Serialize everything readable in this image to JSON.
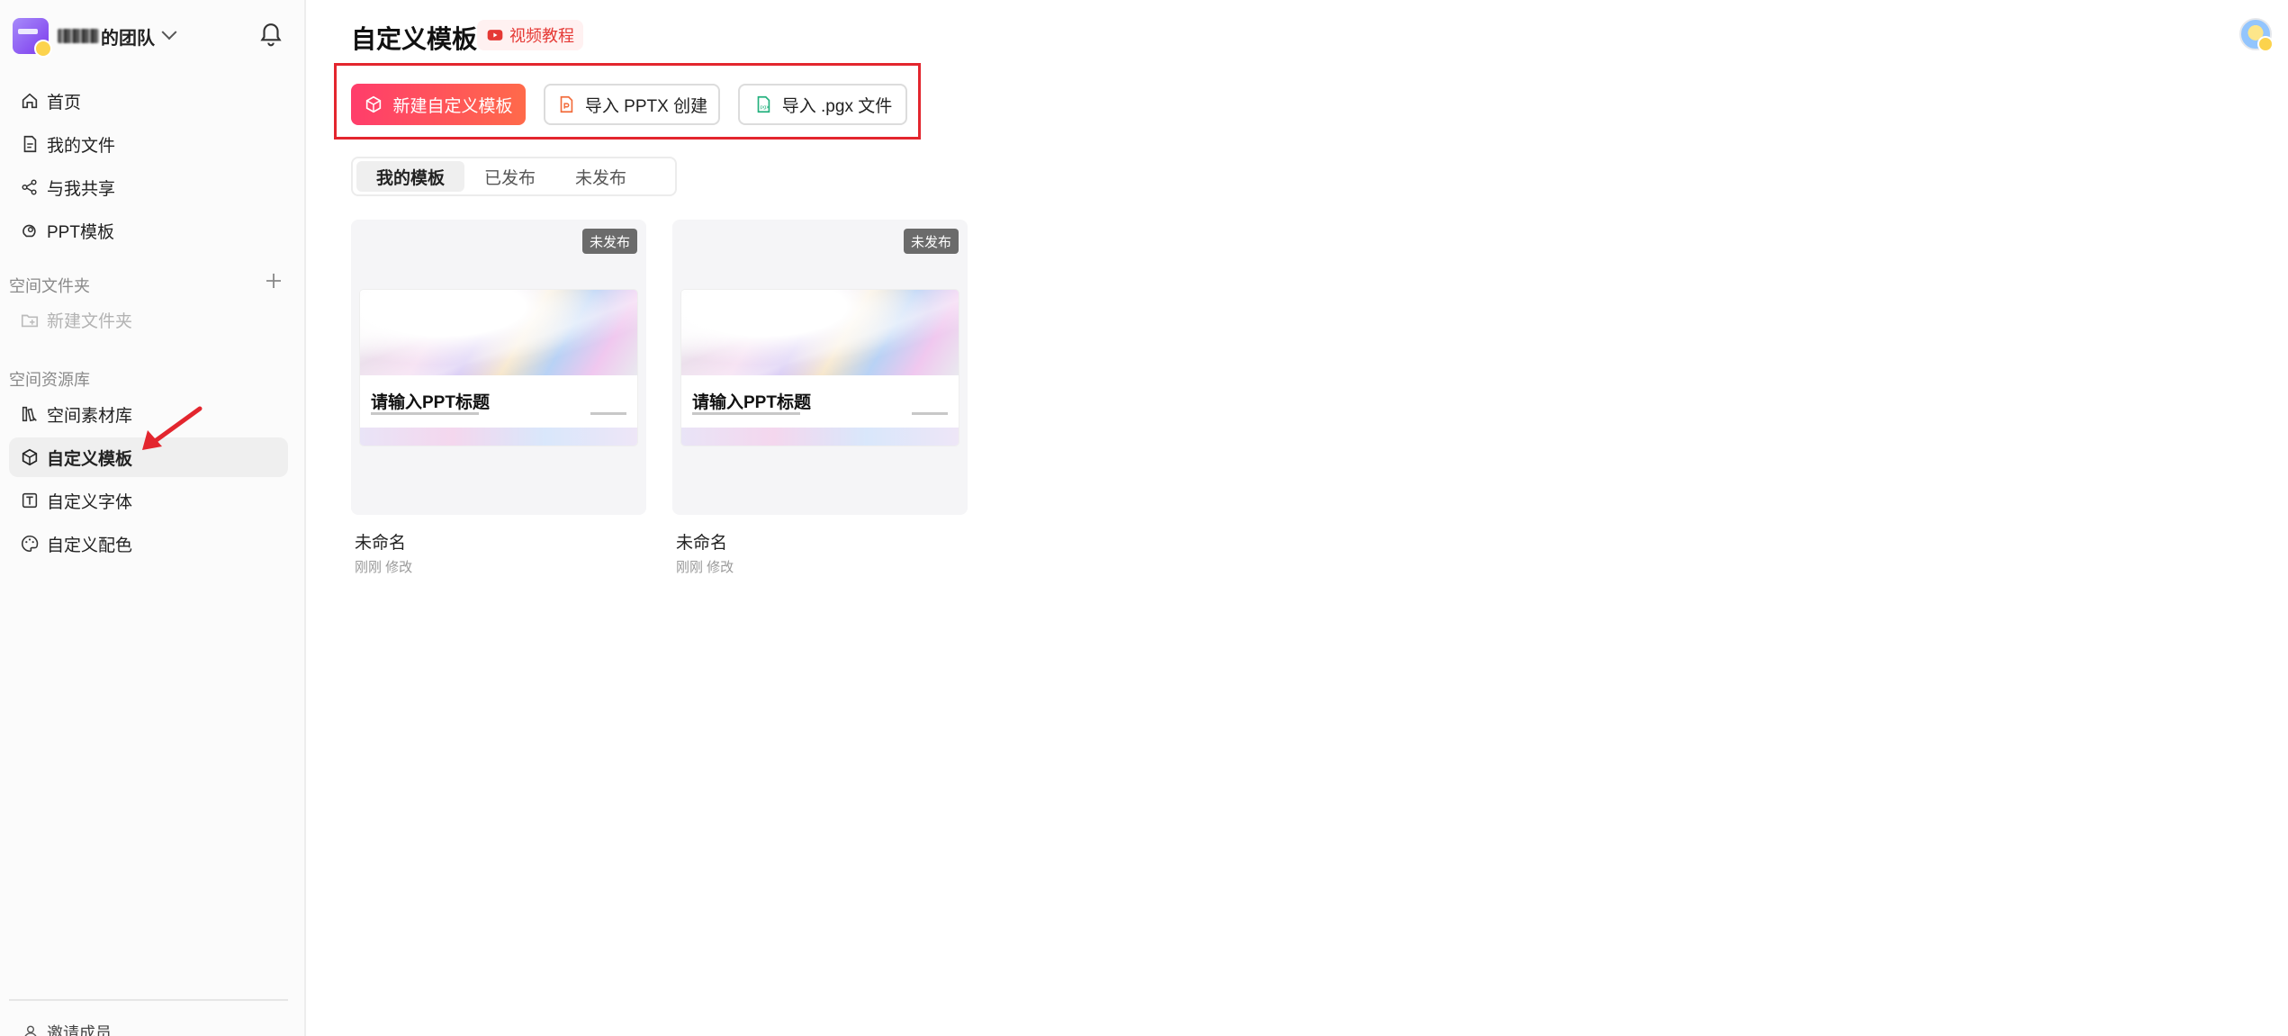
{
  "team": {
    "name_suffix": "的团队"
  },
  "sidebar": {
    "nav": [
      {
        "label": "首页",
        "icon": "home-icon"
      },
      {
        "label": "我的文件",
        "icon": "file-icon"
      },
      {
        "label": "与我共享",
        "icon": "share-icon"
      },
      {
        "label": "PPT模板",
        "icon": "template-icon"
      }
    ],
    "space_folder_label": "空间文件夹",
    "new_folder_label": "新建文件夹",
    "space_library_label": "空间资源库",
    "library": [
      {
        "label": "空间素材库",
        "icon": "material-icon"
      },
      {
        "label": "自定义模板",
        "icon": "cube-icon",
        "active": true
      },
      {
        "label": "自定义字体",
        "icon": "font-icon"
      },
      {
        "label": "自定义配色",
        "icon": "palette-icon"
      }
    ],
    "invite_label": "邀请成员"
  },
  "header": {
    "title": "自定义模板",
    "video_link": "视频教程"
  },
  "actions": {
    "new_template": "新建自定义模板",
    "import_pptx": "导入 PPTX 创建",
    "import_pgx": "导入 .pgx 文件"
  },
  "tabs": [
    {
      "label": "我的模板",
      "active": true
    },
    {
      "label": "已发布"
    },
    {
      "label": "未发布"
    }
  ],
  "cards": [
    {
      "badge": "未发布",
      "thumb_title": "请输入PPT标题",
      "name": "未命名",
      "meta": "刚刚 修改"
    },
    {
      "badge": "未发布",
      "thumb_title": "请输入PPT标题",
      "name": "未命名",
      "meta": "刚刚 修改"
    }
  ],
  "colors": {
    "accent": "#ff3d6b",
    "highlight_border": "#e3262e",
    "badge_bg": "#6b6b6b"
  }
}
